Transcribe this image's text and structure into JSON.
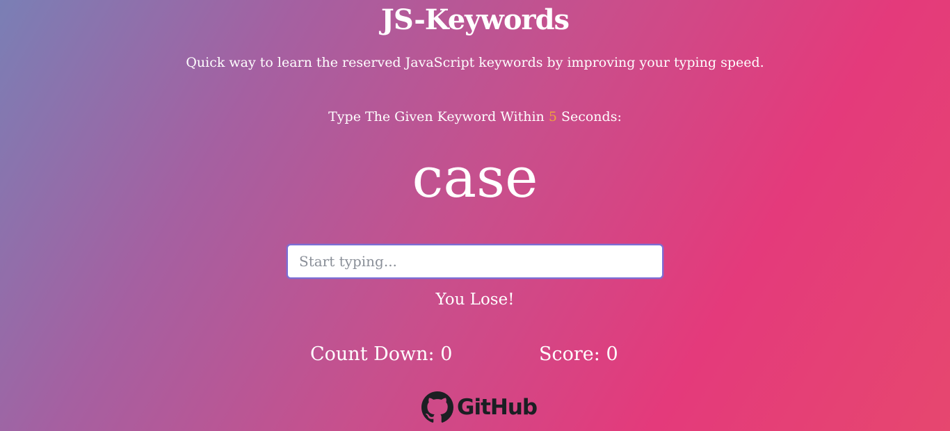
{
  "header": {
    "title": "JS-Keywords",
    "subtitle": "Quick way to learn the reserved JavaScript keywords by improving your typing speed."
  },
  "instruction": {
    "prefix": "Type The Given Keyword Within ",
    "seconds": "5",
    "suffix": " Seconds:"
  },
  "game": {
    "current_word": "case",
    "input_value": "",
    "input_placeholder": "Start typing...",
    "message": "You Lose!"
  },
  "stats": {
    "countdown_label": "Count Down: ",
    "countdown_value": "0",
    "score_label": "Score: ",
    "score_value": "0"
  },
  "footer": {
    "github_label": "GitHub",
    "github_icon": "github-octocat-icon"
  },
  "colors": {
    "seconds_accent": "#f0a53a",
    "input_border": "#7b6fd6"
  }
}
